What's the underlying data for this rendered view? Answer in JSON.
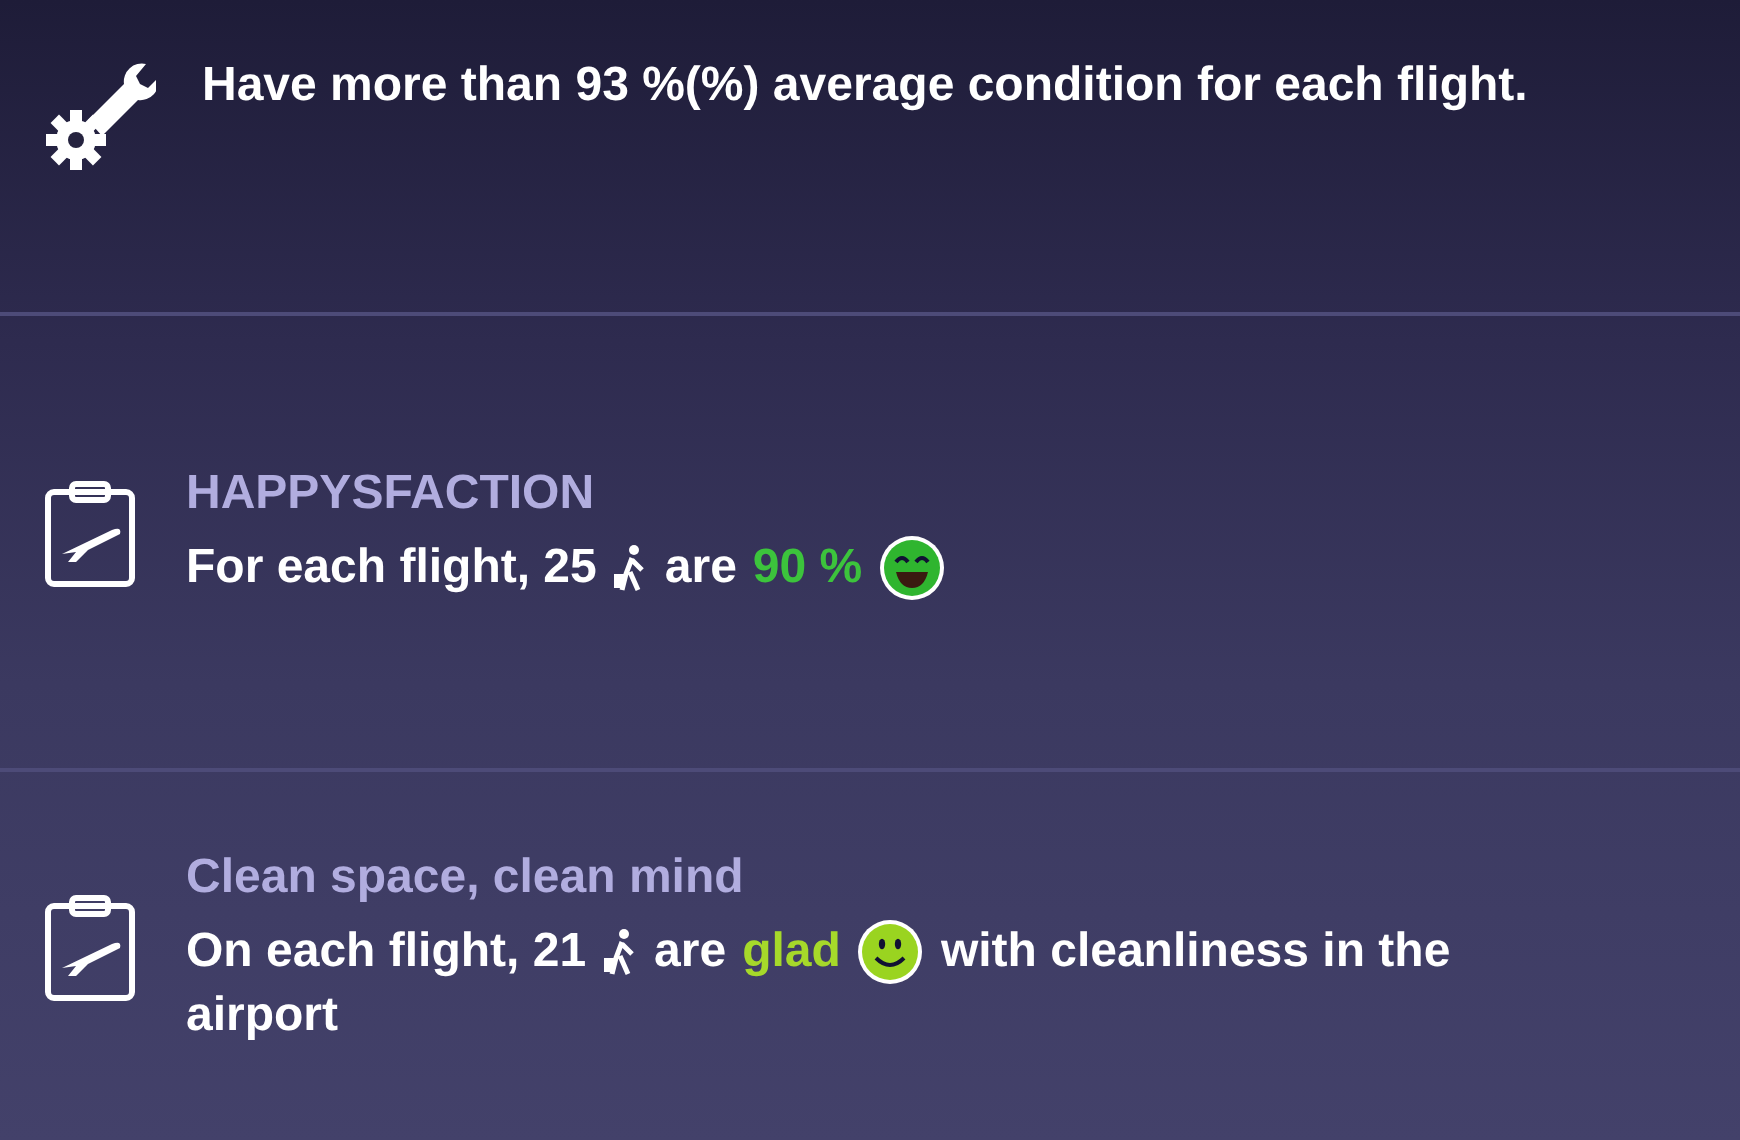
{
  "objectives": [
    {
      "kind": "condition",
      "parts": [
        {
          "kind": "text",
          "text": "Have more than 93 %(%) average condition for each flight."
        }
      ]
    },
    {
      "kind": "mission",
      "title": "HAPPYSFACTION",
      "parts": [
        {
          "kind": "text",
          "text": "For each flight, 25"
        },
        {
          "kind": "passenger"
        },
        {
          "kind": "text",
          "text": "are"
        },
        {
          "kind": "highlight",
          "text": "90 %",
          "color": "#3cc43c"
        },
        {
          "kind": "grin",
          "color": "#2fb52f"
        }
      ]
    },
    {
      "kind": "mission",
      "title": "Clean space, clean mind",
      "parts": [
        {
          "kind": "text",
          "text": "On each flight, 21"
        },
        {
          "kind": "passenger"
        },
        {
          "kind": "text",
          "text": "are"
        },
        {
          "kind": "highlight",
          "text": "glad",
          "color": "#a6d92a"
        },
        {
          "kind": "smile",
          "color": "#9ad420"
        },
        {
          "kind": "text",
          "text": "with cleanliness in the"
        },
        {
          "kind": "text",
          "text": "airport"
        }
      ]
    }
  ]
}
